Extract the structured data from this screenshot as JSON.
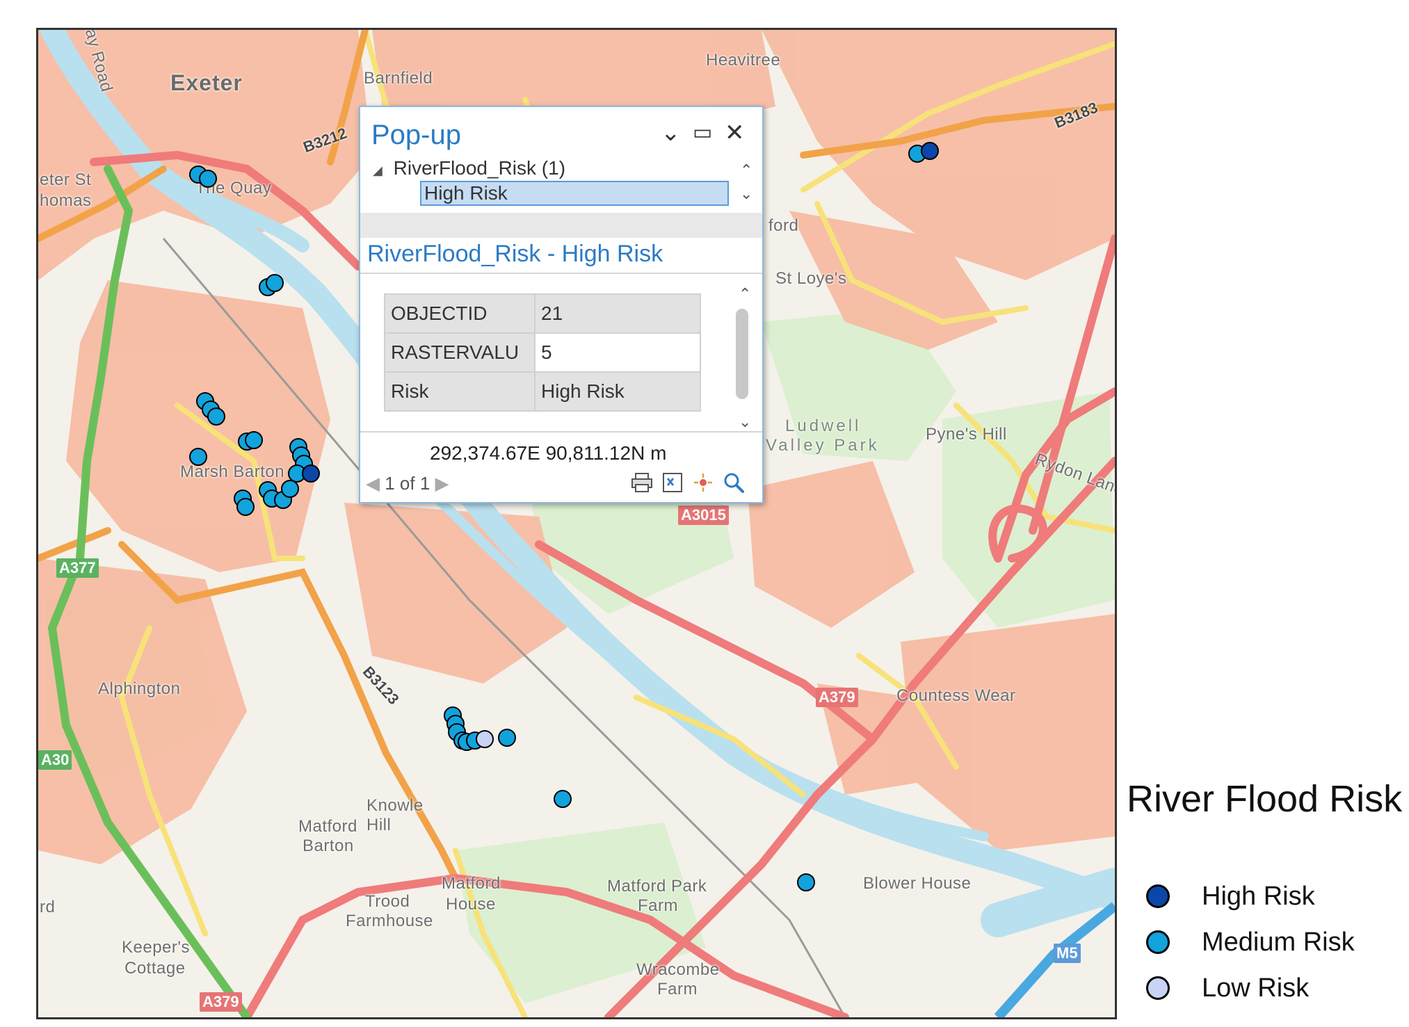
{
  "map": {
    "places": [
      {
        "id": "exeter",
        "text": "Exeter"
      },
      {
        "id": "barnfield",
        "text": "Barnfield"
      },
      {
        "id": "heavitree",
        "text": "Heavitree"
      },
      {
        "id": "thequay",
        "text": "The Quay"
      },
      {
        "id": "stthomas1",
        "text": "eter St"
      },
      {
        "id": "stthomas2",
        "text": "homas"
      },
      {
        "id": "ford",
        "text": "ford"
      },
      {
        "id": "stloyes",
        "text": "St Loye's"
      },
      {
        "id": "ludwell1",
        "text": "Ludwell"
      },
      {
        "id": "ludwell2",
        "text": "Valley Park"
      },
      {
        "id": "pyneshill",
        "text": "Pyne's Hill"
      },
      {
        "id": "marshbarton",
        "text": "Marsh Barton"
      },
      {
        "id": "alphington",
        "text": "Alphington"
      },
      {
        "id": "countesswear",
        "text": "Countess Wear"
      },
      {
        "id": "knowle",
        "text": "Knowle"
      },
      {
        "id": "hill",
        "text": "Hill"
      },
      {
        "id": "matfordbarton1",
        "text": "Matford"
      },
      {
        "id": "matfordbarton2",
        "text": "Barton"
      },
      {
        "id": "matfordhouse1",
        "text": "Matford"
      },
      {
        "id": "matfordhouse2",
        "text": "House"
      },
      {
        "id": "matfordpark1",
        "text": "Matford Park"
      },
      {
        "id": "matfordpark2",
        "text": "Farm"
      },
      {
        "id": "trood1",
        "text": "Trood"
      },
      {
        "id": "trood2",
        "text": "Farmhouse"
      },
      {
        "id": "keepers1",
        "text": "Keeper's"
      },
      {
        "id": "keepers2",
        "text": "Cottage"
      },
      {
        "id": "blower",
        "text": "Blower House"
      },
      {
        "id": "wracombe1",
        "text": "Wracombe"
      },
      {
        "id": "wracombe2",
        "text": "Farm"
      },
      {
        "id": "rd",
        "text": "rd"
      },
      {
        "id": "rydon",
        "text": "Rydon Lane"
      },
      {
        "id": "ayroad",
        "text": "ay Road"
      }
    ],
    "roads": {
      "a3015": "A3015",
      "a377": "A377",
      "a379_mid": "A379",
      "a379_bottom": "A379",
      "a30": "A30",
      "m5": "M5",
      "b3212": "B3212",
      "b3183": "B3183",
      "b3123": "B3123"
    },
    "colors": {
      "high": "#0a47a9",
      "medium": "#12a3dc",
      "low": "#c9d4f5",
      "urban": "#f7b9a0",
      "water": "#b8e0ef",
      "motorway": "#4aa8e0",
      "primary": "#ef7b7b",
      "trunk": "#6bbf5a",
      "secondary": "#f2a248",
      "minor": "#f7e27a"
    },
    "points": [
      {
        "risk": "medium"
      },
      {
        "risk": "medium"
      },
      {
        "risk": "medium"
      },
      {
        "risk": "medium"
      },
      {
        "risk": "medium"
      },
      {
        "risk": "medium"
      },
      {
        "risk": "medium"
      },
      {
        "risk": "medium"
      },
      {
        "risk": "medium"
      },
      {
        "risk": "medium"
      },
      {
        "risk": "medium"
      },
      {
        "risk": "medium"
      },
      {
        "risk": "medium"
      },
      {
        "risk": "medium"
      },
      {
        "risk": "medium"
      },
      {
        "risk": "medium"
      },
      {
        "risk": "medium"
      },
      {
        "risk": "medium"
      },
      {
        "risk": "medium"
      },
      {
        "risk": "medium"
      },
      {
        "risk": "high"
      },
      {
        "risk": "medium"
      },
      {
        "risk": "medium"
      },
      {
        "risk": "medium"
      },
      {
        "risk": "medium"
      },
      {
        "risk": "medium"
      },
      {
        "risk": "medium"
      },
      {
        "risk": "low"
      },
      {
        "risk": "medium"
      },
      {
        "risk": "medium"
      },
      {
        "risk": "high"
      },
      {
        "risk": "medium"
      },
      {
        "risk": "medium"
      }
    ]
  },
  "popup": {
    "title": "Pop-up",
    "minimize_glyph": "⌄",
    "maximize_glyph": "▭",
    "close_glyph": "✕",
    "layer_item": "RiverFlood_Risk (1)",
    "selected_item": "High Risk",
    "feature_title": "RiverFlood_Risk - High Risk",
    "attributes": [
      {
        "key": "OBJECTID",
        "value": "21"
      },
      {
        "key": "RASTERVALU",
        "value": "5"
      },
      {
        "key": "Risk",
        "value": "High Risk"
      }
    ],
    "coordinates": "292,374.67E 90,811.12N m",
    "pager": "1 of 1",
    "tools": [
      "print-icon",
      "zoom-to-icon",
      "flash-icon",
      "search-icon"
    ]
  },
  "legend": {
    "title": "River Flood Risk",
    "items": [
      {
        "label": "High Risk",
        "color": "#0a47a9"
      },
      {
        "label": "Medium Risk",
        "color": "#12a3dc"
      },
      {
        "label": "Low Risk",
        "color": "#c9d4f5"
      }
    ]
  }
}
